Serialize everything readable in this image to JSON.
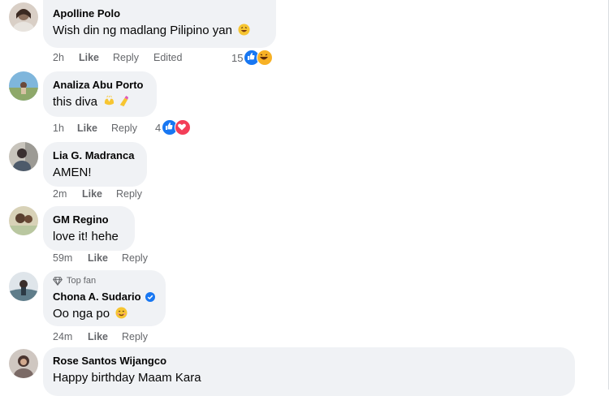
{
  "comments": [
    {
      "name": "Apolline Polo",
      "text": "Wish din ng madlang Pilipino yan",
      "emoji": "grinning-face-emoji",
      "time": "2h",
      "like": "Like",
      "reply": "Reply",
      "edited": "Edited",
      "reaction_count": "15",
      "reactions": [
        "like-icon",
        "haha-icon"
      ]
    },
    {
      "name": "Analiza Abu Porto",
      "text": "this diva",
      "emojis": [
        "hands-emoji",
        "nail-polish-emoji"
      ],
      "time": "1h",
      "like": "Like",
      "reply": "Reply",
      "reaction_count": "4",
      "reactions": [
        "like-icon",
        "love-icon"
      ]
    },
    {
      "name": "Lia G. Madranca",
      "text": "AMEN!",
      "time": "2m",
      "like": "Like",
      "reply": "Reply"
    },
    {
      "name": "GM Regino",
      "text": "love it! hehe",
      "time": "59m",
      "like": "Like",
      "reply": "Reply"
    },
    {
      "badge": "Top fan",
      "badge_icon": "diamond-icon",
      "name": "Chona A. Sudario",
      "verified_icon": "verified-badge-icon",
      "text": "Oo nga po",
      "emoji": "smiling-face-emoji",
      "time": "24m",
      "like": "Like",
      "reply": "Reply"
    },
    {
      "name": "Rose Santos Wijangco",
      "text": "Happy birthday Maam Kara"
    }
  ],
  "colors": {
    "bubble": "#f0f2f5",
    "meta_text": "#65676b",
    "like_blue": "#1877f2",
    "love_red": "#f33e58",
    "haha_yellow": "#f7b125"
  }
}
